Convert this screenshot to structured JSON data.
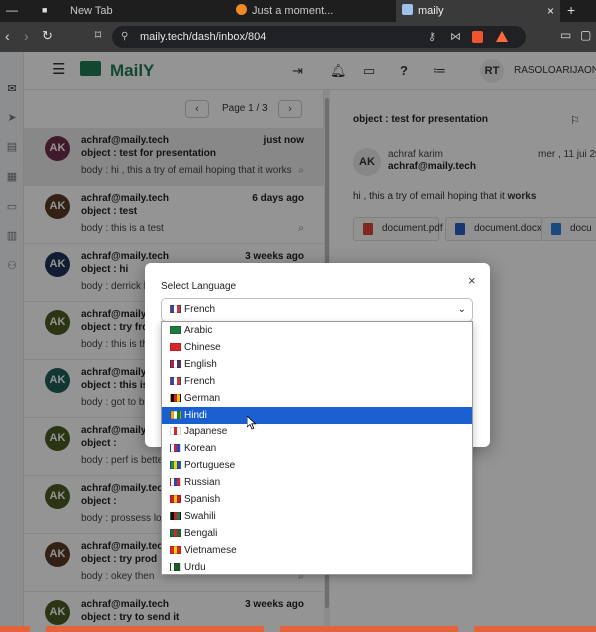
{
  "browser": {
    "window_controls": [
      "—",
      "■"
    ],
    "tabs": [
      {
        "label": "New Tab",
        "active": false
      },
      {
        "label": "Just a moment...",
        "active": false
      },
      {
        "label": "maily",
        "active": true,
        "close": "×"
      }
    ],
    "new_tab": "+",
    "url": "maily.tech/dash/inbox/804"
  },
  "app": {
    "logo": "MailY",
    "user_initials": "RT",
    "user_name": "RASOLOARIJAONA"
  },
  "pager": {
    "label": "Page 1 / 3",
    "prev": "‹",
    "next": "›"
  },
  "inbox": [
    {
      "initials": "AK",
      "color": "#6b2d4b",
      "from": "achraf@maily.tech",
      "time": "just now",
      "object": "object : test for presentation",
      "body": "body : hi , this a try of email hoping that it works",
      "selected": true
    },
    {
      "initials": "AK",
      "color": "#5a3a26",
      "from": "achraf@maily.tech",
      "time": "6 days ago",
      "object": "object : test",
      "body": "body : this is a test",
      "selected": false
    },
    {
      "initials": "AK",
      "color": "#1e3358",
      "from": "achraf@maily.tech",
      "time": "3 weeks ago",
      "object": "object : hi",
      "body": "body : derrick h",
      "selected": false
    },
    {
      "initials": "AK",
      "color": "#4a5a22",
      "from": "achraf@maily.tech",
      "time": "",
      "object": "object : try fro",
      "body": "body : this is th",
      "selected": false
    },
    {
      "initials": "AK",
      "color": "#1f5e56",
      "from": "achraf@maily.tech",
      "time": "",
      "object": "object : this is",
      "body": "body : got to be",
      "selected": false
    },
    {
      "initials": "AK",
      "color": "#4a5a22",
      "from": "achraf@maily.tech",
      "time": "",
      "object": "object :",
      "body": "body : perf is bette",
      "selected": false
    },
    {
      "initials": "AK",
      "color": "#4a5a22",
      "from": "achraf@maily.tech",
      "time": "",
      "object": "object :",
      "body": "body : prossess loa",
      "selected": false
    },
    {
      "initials": "AK",
      "color": "#5a3a26",
      "from": "achraf@maily.tech",
      "time": "",
      "object": "object : try prod",
      "body": "body : okey then",
      "selected": false
    },
    {
      "initials": "AK",
      "color": "#4a5a22",
      "from": "achraf@maily.tech",
      "time": "3 weeks ago",
      "object": "object : try to send it",
      "body": "",
      "selected": false
    }
  ],
  "reader": {
    "object": "object : test for presentation",
    "sender_initials": "AK",
    "sender_name": "achraf karim",
    "sender_email": "achraf@maily.tech",
    "date": "mer , 11 jui 25",
    "body_prefix": "hi , this a try of email hoping that it ",
    "body_bold": "works",
    "attachments": [
      {
        "name": "document.pdf",
        "icon": "pdf-icon",
        "color": "#d9453a"
      },
      {
        "name": "document.docx",
        "icon": "docx-icon",
        "color": "#2b5fbf"
      },
      {
        "name": "docu",
        "icon": "image-icon",
        "color": "#2b7fd9"
      }
    ]
  },
  "modal": {
    "title": "Select Language",
    "close": "×",
    "selected_value": "French",
    "selected_flag": [
      "#1d4fb8",
      "#ffffff",
      "#d23a32"
    ],
    "options": [
      {
        "label": "Arabic",
        "flag": [
          "#1d7a3a",
          "#1d7a3a",
          "#1d7a3a"
        ]
      },
      {
        "label": "Chinese",
        "flag": [
          "#d8262b",
          "#d8262b",
          "#d8262b"
        ]
      },
      {
        "label": "English",
        "flag": [
          "#b22234",
          "#ffffff",
          "#3c3b6e"
        ]
      },
      {
        "label": "French",
        "flag": [
          "#1d4fb8",
          "#ffffff",
          "#d23a32"
        ]
      },
      {
        "label": "German",
        "flag": [
          "#000000",
          "#d6232a",
          "#f5c400"
        ]
      },
      {
        "label": "Hindi",
        "flag": [
          "#f59a32",
          "#ffffff",
          "#138808"
        ],
        "highlighted": true
      },
      {
        "label": "Japanese",
        "flag": [
          "#ffffff",
          "#d8262b",
          "#ffffff"
        ]
      },
      {
        "label": "Korean",
        "flag": [
          "#ffffff",
          "#c8233a",
          "#1d4fb8"
        ]
      },
      {
        "label": "Portuguese",
        "flag": [
          "#2a8c3a",
          "#f5d400",
          "#1d4fb8"
        ]
      },
      {
        "label": "Russian",
        "flag": [
          "#ffffff",
          "#1d4fb8",
          "#d8262b"
        ]
      },
      {
        "label": "Spanish",
        "flag": [
          "#c8202b",
          "#f5c400",
          "#c8202b"
        ]
      },
      {
        "label": "Swahili",
        "flag": [
          "#111111",
          "#c8202b",
          "#1d7a3a"
        ]
      },
      {
        "label": "Bengali",
        "flag": [
          "#1d6a3a",
          "#d8262b",
          "#1d6a3a"
        ]
      },
      {
        "label": "Vietnamese",
        "flag": [
          "#d8262b",
          "#f5d400",
          "#d8262b"
        ]
      },
      {
        "label": "Urdu",
        "flag": [
          "#ffffff",
          "#1a5a2a",
          "#1a5a2a"
        ]
      }
    ]
  },
  "colors": {
    "brand": "#1f7a55",
    "highlight": "#1a5fd0",
    "accent_orange": "#e4633a"
  }
}
